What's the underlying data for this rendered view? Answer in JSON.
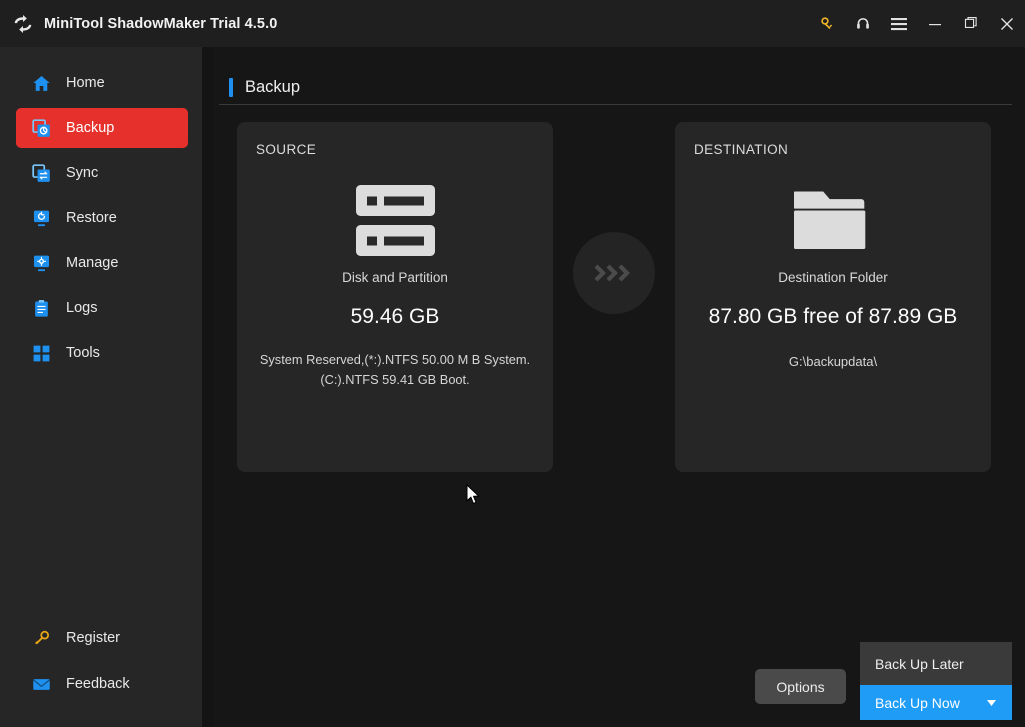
{
  "window": {
    "title": "MiniTool ShadowMaker Trial 4.5.0",
    "logo_icon": "sync-circular-arrows-logo",
    "controls": [
      {
        "name": "key-icon",
        "label": "Register"
      },
      {
        "name": "headphones-icon",
        "label": "Support"
      },
      {
        "name": "hamburger-menu-icon",
        "label": "Menu"
      },
      {
        "name": "minimize-icon",
        "label": "Minimize"
      },
      {
        "name": "maximize-icon",
        "label": "Maximize"
      },
      {
        "name": "close-icon",
        "label": "Close"
      }
    ]
  },
  "sidebar": {
    "items": [
      {
        "label": "Home",
        "icon": "home-icon",
        "active": false
      },
      {
        "label": "Backup",
        "icon": "backup-icon",
        "active": true
      },
      {
        "label": "Sync",
        "icon": "sync-icon",
        "active": false
      },
      {
        "label": "Restore",
        "icon": "restore-icon",
        "active": false
      },
      {
        "label": "Manage",
        "icon": "manage-icon",
        "active": false
      },
      {
        "label": "Logs",
        "icon": "logs-icon",
        "active": false
      },
      {
        "label": "Tools",
        "icon": "tools-icon",
        "active": false
      }
    ],
    "bottom_items": [
      {
        "label": "Register",
        "icon": "key-icon"
      },
      {
        "label": "Feedback",
        "icon": "envelope-icon"
      }
    ]
  },
  "page": {
    "title": "Backup"
  },
  "source_panel": {
    "kicker": "SOURCE",
    "icon": "disk-partition-icon",
    "subtitle": "Disk and Partition",
    "size": "59.46 GB",
    "detail_line_1": "System Reserved,(*:).NTFS 50.00 M B System.",
    "detail_line_2": "(C:).NTFS 59.41 GB Boot."
  },
  "destination_panel": {
    "kicker": "DESTINATION",
    "icon": "folder-icon",
    "subtitle": "Destination Folder",
    "capacity": "87.80 GB free of 87.89 GB",
    "path": "G:\\backupdata\\"
  },
  "transfer_arrow": {
    "icon": "triple-chevron-right-icon"
  },
  "footer": {
    "options_label": "Options",
    "back_up_later_label": "Back Up Later",
    "back_up_now_label": "Back Up Now",
    "caret_icon": "caret-down-icon"
  },
  "colors": {
    "accent_blue": "#1f9cf5",
    "active_red": "#e5302b",
    "icon_blue": "#1e90f0",
    "key_yellow": "#e8a417",
    "panel_bg": "#262626",
    "content_bg": "#161616",
    "sidebar_bg": "#262626",
    "titlebar_bg": "#1f1f1f"
  }
}
